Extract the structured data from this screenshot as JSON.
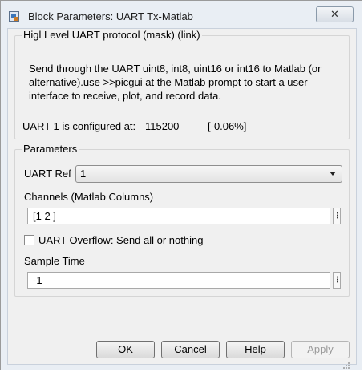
{
  "window": {
    "title": "Block Parameters: UART Tx-Matlab",
    "close_label": "✕"
  },
  "mask_group": {
    "legend": "Higl Level UART protocol (mask) (link)",
    "description": "Send through the UART uint8, int8, uint16 or int16 to Matlab (or alternative).use >>picgui at the Matlab prompt to start a user interface to receive, plot, and record data.",
    "uart_config_label": "UART 1 is configured at:",
    "uart_baud": "115200",
    "uart_error": "[-0.06%]"
  },
  "parameters": {
    "legend": "Parameters",
    "uart_ref_label": "UART Ref",
    "uart_ref_value": "1",
    "channels_label": "Channels (Matlab Columns)",
    "channels_value": "[1 2 ]",
    "overflow_label": "UART Overflow: Send all or nothing",
    "overflow_checked": false,
    "sample_time_label": "Sample Time",
    "sample_time_value": "-1",
    "more_label": "⋮"
  },
  "buttons": {
    "ok": "OK",
    "cancel": "Cancel",
    "help": "Help",
    "apply": "Apply"
  },
  "icons": {
    "window": "simulink-block-icon",
    "close": "close-icon",
    "dropdown": "chevron-down-icon",
    "more": "vertical-ellipsis-icon"
  }
}
